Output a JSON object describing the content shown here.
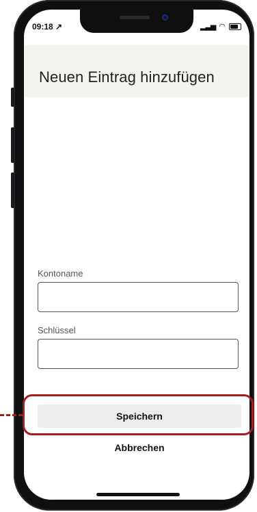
{
  "status_bar": {
    "time": "09:18 ↗",
    "signal_icon": "cellular-signal-icon",
    "wifi_icon": "wifi-icon",
    "battery_icon": "battery-icon"
  },
  "page": {
    "title": "Neuen Eintrag hinzufügen"
  },
  "form": {
    "account_name_label": "Kontoname",
    "account_name_value": "",
    "key_label": "Schlüssel",
    "key_value": ""
  },
  "actions": {
    "save_label": "Speichern",
    "cancel_label": "Abbrechen"
  },
  "colors": {
    "header_bg": "#f3f3f2",
    "button_bg": "#ececec",
    "highlight": "#a51d1d"
  }
}
